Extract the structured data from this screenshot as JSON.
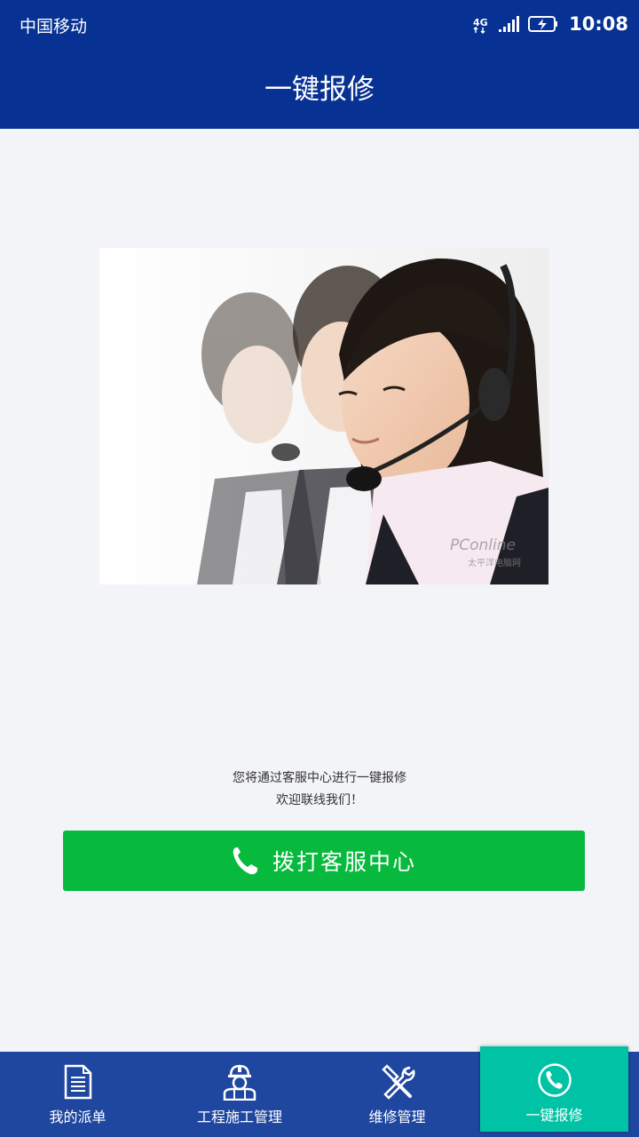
{
  "status_bar": {
    "carrier": "中国移动",
    "time": "10:08"
  },
  "header": {
    "title": "一键报修"
  },
  "hero": {
    "watermark_brand": "PConline",
    "watermark_sub": "太平洋电脑网"
  },
  "hint": {
    "line1": "您将通过客服中心进行一键报修",
    "line2": "欢迎联线我们！"
  },
  "call_button": {
    "label": "拨打客服中心",
    "icon": "phone-icon"
  },
  "tabs": [
    {
      "label": "我的派单",
      "icon": "document-icon",
      "active": false
    },
    {
      "label": "工程施工管理",
      "icon": "worker-icon",
      "active": false
    },
    {
      "label": "维修管理",
      "icon": "tools-icon",
      "active": false
    },
    {
      "label": "一键报修",
      "icon": "phone-circle-icon",
      "active": true
    }
  ],
  "colors": {
    "primary": "#073192",
    "tabbar": "#2047a0",
    "active_tab": "#00c3a5",
    "call_button": "#07ba3e",
    "background": "#f3f4f8"
  }
}
